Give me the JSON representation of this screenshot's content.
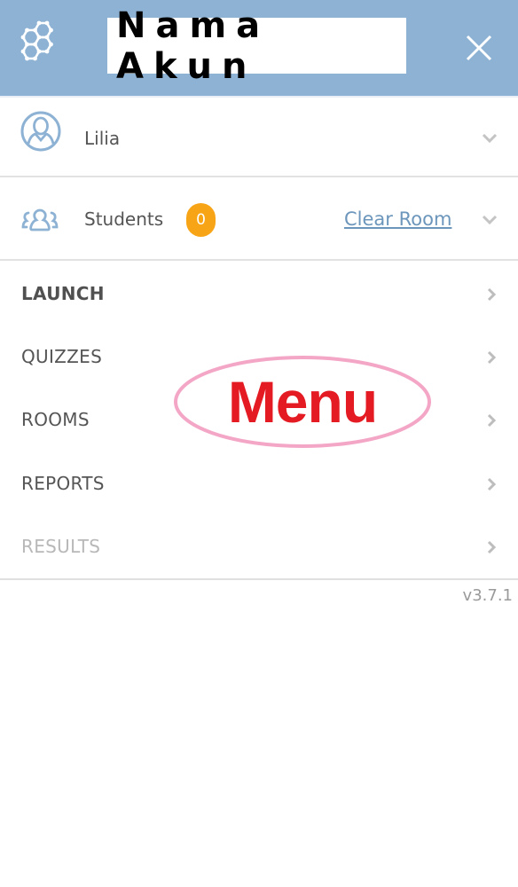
{
  "header": {
    "logo_icon": "hexagon-network-icon",
    "title": "Nama Akun",
    "close_icon": "close-icon",
    "background_color": "#8db2d4"
  },
  "account": {
    "icon": "user-circle-icon",
    "name": "Lilia",
    "expand_icon": "chevron-down-icon"
  },
  "students": {
    "icon": "group-icon",
    "label": "Students",
    "count": "0",
    "count_badge_color": "#f7a416",
    "clear_room_label": "Clear Room",
    "expand_icon": "chevron-down-icon"
  },
  "menu": {
    "items": [
      {
        "label": "LAUNCH",
        "style": "bold",
        "enabled": true
      },
      {
        "label": "QUIZZES",
        "style": "normal",
        "enabled": true
      },
      {
        "label": "ROOMS",
        "style": "normal",
        "enabled": true
      },
      {
        "label": "REPORTS",
        "style": "normal",
        "enabled": true
      },
      {
        "label": "RESULTS",
        "style": "normal",
        "enabled": false
      }
    ]
  },
  "version": "v3.7.1",
  "annotation": {
    "text": "Menu",
    "text_color": "#e41b23",
    "outline_color": "#f4a6c6"
  }
}
